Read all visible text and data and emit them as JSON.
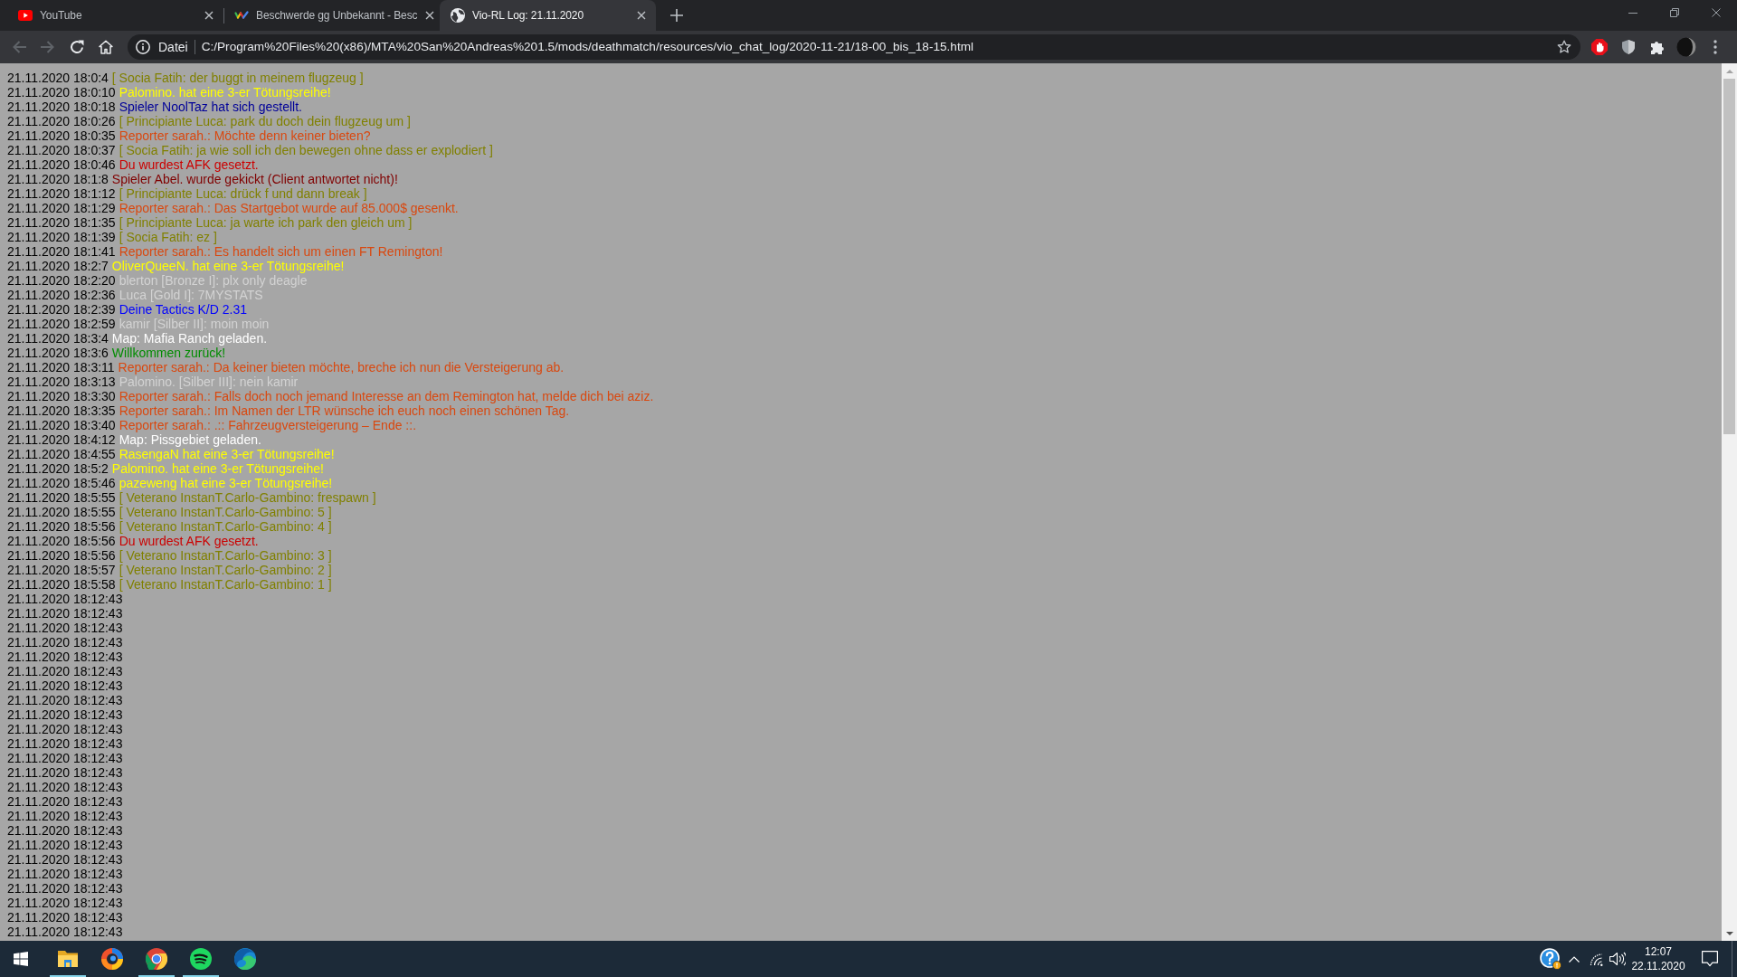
{
  "browser": {
    "tabs": [
      {
        "title": "YouTube",
        "selected": false
      },
      {
        "title": "Beschwerde gg Unbekannt - Besc",
        "selected": false
      },
      {
        "title": "Vio-RL Log: 21.11.2020",
        "selected": true
      }
    ],
    "nav_buttons": [
      {
        "disabled": true
      },
      {
        "disabled": true
      },
      {
        "disabled": false
      },
      {
        "disabled": false
      }
    ],
    "address_bar": {
      "site_info": "Datei",
      "url": "C:/Program%20Files%20(x86)/MTA%20San%20Andreas%201.5/mods/deathmatch/resources/vio_chat_log/2020-11-21/18-00_bis_18-15.html"
    }
  },
  "log": [
    {
      "time": "21.11.2020 18:0:4",
      "text": "[ Socia Fatih: der buggt in meinem flugzeug ]",
      "color": "#808000"
    },
    {
      "time": "21.11.2020 18:0:10",
      "text": "Palomino. hat eine 3-er Tötungsreihe!",
      "color": "#ffff00"
    },
    {
      "time": "21.11.2020 18:0:18",
      "text": "Spieler NoolTaz hat sich gestellt.",
      "color": "#000099"
    },
    {
      "time": "21.11.2020 18:0:26",
      "text": "[ Principiante Luca: park du doch dein flugzeug um ]",
      "color": "#808000"
    },
    {
      "time": "21.11.2020 18:0:35",
      "text": "Reporter sarah.: Möchte denn keiner bieten?",
      "color": "#d9480f"
    },
    {
      "time": "21.11.2020 18:0:37",
      "text": "[ Socia Fatih: ja wie soll ich den bewegen ohne dass er explodiert ]",
      "color": "#808000"
    },
    {
      "time": "21.11.2020 18:0:46",
      "text": "Du wurdest AFK gesetzt.",
      "color": "#cc0000"
    },
    {
      "time": "21.11.2020 18:1:8",
      "text": "Spieler Abel. wurde gekickt (Client antwortet nicht)!",
      "color": "#800000"
    },
    {
      "time": "21.11.2020 18:1:12",
      "text": "[ Principiante Luca: drück f und dann break ]",
      "color": "#808000"
    },
    {
      "time": "21.11.2020 18:1:29",
      "text": "Reporter sarah.: Das Startgebot wurde auf 85.000$ gesenkt.",
      "color": "#d9480f"
    },
    {
      "time": "21.11.2020 18:1:35",
      "text": "[ Principiante Luca: ja warte ich park den gleich um ]",
      "color": "#808000"
    },
    {
      "time": "21.11.2020 18:1:39",
      "text": "[ Socia Fatih: ez ]",
      "color": "#808000"
    },
    {
      "time": "21.11.2020 18:1:41",
      "text": "Reporter sarah.: Es handelt sich um einen FT Remington!",
      "color": "#d9480f"
    },
    {
      "time": "21.11.2020 18:2:7",
      "text": "OliverQueeN. hat eine 3-er Tötungsreihe!",
      "color": "#ffff00"
    },
    {
      "time": "21.11.2020 18:2:20",
      "text": "blerton [Bronze I]: plx only deagle",
      "color": "#d3d3d3"
    },
    {
      "time": "21.11.2020 18:2:36",
      "text": "Luca [Gold I]: 7MYSTATS",
      "color": "#d3d3d3"
    },
    {
      "time": "21.11.2020 18:2:39",
      "text": "Deine Tactics K/D 2.31",
      "color": "#0000ff"
    },
    {
      "time": "21.11.2020 18:2:59",
      "text": "kamir [Silber II]: moin moin",
      "color": "#d3d3d3"
    },
    {
      "time": "21.11.2020 18:3:4",
      "text": "Map: Mafia Ranch geladen.",
      "color": "#ffffff"
    },
    {
      "time": "21.11.2020 18:3:6",
      "text": "Willkommen zurück!",
      "color": "#008c00"
    },
    {
      "time": "21.11.2020 18:3:11",
      "text": "Reporter sarah.: Da keiner bieten möchte, breche ich nun die Versteigerung ab.",
      "color": "#d9480f"
    },
    {
      "time": "21.11.2020 18:3:13",
      "text": "Palomino. [Silber III]: nein kamir",
      "color": "#d3d3d3"
    },
    {
      "time": "21.11.2020 18:3:30",
      "text": "Reporter sarah.: Falls doch noch jemand Interesse an dem Remington hat, melde dich bei aziz.",
      "color": "#d9480f"
    },
    {
      "time": "21.11.2020 18:3:35",
      "text": "Reporter sarah.: Im Namen der LTR wünsche ich euch noch einen schönen Tag.",
      "color": "#d9480f"
    },
    {
      "time": "21.11.2020 18:3:40",
      "text": "Reporter sarah.: .:: Fahrzeugversteigerung – Ende ::.",
      "color": "#d9480f"
    },
    {
      "time": "21.11.2020 18:4:12",
      "text": "Map: Pissgebiet geladen.",
      "color": "#ffffff"
    },
    {
      "time": "21.11.2020 18:4:55",
      "text": "RasengaN hat eine 3-er Tötungsreihe!",
      "color": "#ffff00"
    },
    {
      "time": "21.11.2020 18:5:2",
      "text": "Palomino. hat eine 3-er Tötungsreihe!",
      "color": "#ffff00"
    },
    {
      "time": "21.11.2020 18:5:46",
      "text": "pazeweng hat eine 3-er Tötungsreihe!",
      "color": "#ffff00"
    },
    {
      "time": "21.11.2020 18:5:55",
      "text": "[ Veterano InstanT.Carlo-Gambino: frespawn ]",
      "color": "#808000"
    },
    {
      "time": "21.11.2020 18:5:55",
      "text": "[ Veterano InstanT.Carlo-Gambino: 5 ]",
      "color": "#808000"
    },
    {
      "time": "21.11.2020 18:5:56",
      "text": "[ Veterano InstanT.Carlo-Gambino: 4 ]",
      "color": "#808000"
    },
    {
      "time": "21.11.2020 18:5:56",
      "text": "Du wurdest AFK gesetzt.",
      "color": "#cc0000"
    },
    {
      "time": "21.11.2020 18:5:56",
      "text": "[ Veterano InstanT.Carlo-Gambino: 3 ]",
      "color": "#808000"
    },
    {
      "time": "21.11.2020 18:5:57",
      "text": "[ Veterano InstanT.Carlo-Gambino: 2 ]",
      "color": "#808000"
    },
    {
      "time": "21.11.2020 18:5:58",
      "text": "[ Veterano InstanT.Carlo-Gambino: 1 ]",
      "color": "#808000"
    },
    {
      "time": "21.11.2020 18:12:43"
    },
    {
      "time": "21.11.2020 18:12:43"
    },
    {
      "time": "21.11.2020 18:12:43"
    },
    {
      "time": "21.11.2020 18:12:43"
    },
    {
      "time": "21.11.2020 18:12:43"
    },
    {
      "time": "21.11.2020 18:12:43"
    },
    {
      "time": "21.11.2020 18:12:43"
    },
    {
      "time": "21.11.2020 18:12:43"
    },
    {
      "time": "21.11.2020 18:12:43"
    },
    {
      "time": "21.11.2020 18:12:43"
    },
    {
      "time": "21.11.2020 18:12:43"
    },
    {
      "time": "21.11.2020 18:12:43"
    },
    {
      "time": "21.11.2020 18:12:43"
    },
    {
      "time": "21.11.2020 18:12:43"
    },
    {
      "time": "21.11.2020 18:12:43"
    },
    {
      "time": "21.11.2020 18:12:43"
    },
    {
      "time": "21.11.2020 18:12:43"
    },
    {
      "time": "21.11.2020 18:12:43"
    },
    {
      "time": "21.11.2020 18:12:43"
    },
    {
      "time": "21.11.2020 18:12:43"
    },
    {
      "time": "21.11.2020 18:12:43"
    },
    {
      "time": "21.11.2020 18:12:43"
    },
    {
      "time": "21.11.2020 18:12:43"
    },
    {
      "time": "21.11.2020 18:12:43"
    }
  ],
  "taskbar": {
    "apps": [
      {
        "running": true
      },
      {
        "running": false
      },
      {
        "running": true
      },
      {
        "running": true
      },
      {
        "running": false
      }
    ],
    "clock": {
      "time": "12:07",
      "date": "22.11.2020"
    }
  }
}
